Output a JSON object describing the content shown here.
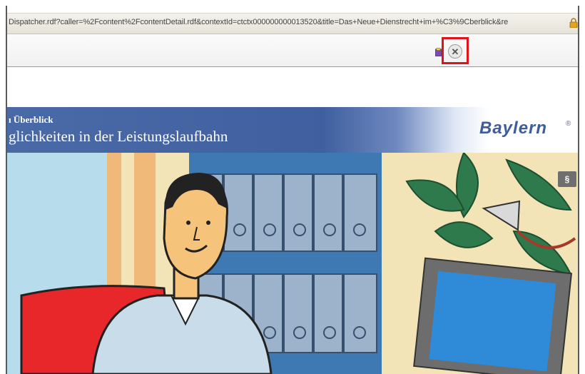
{
  "browser": {
    "url": "Dispatcher.rdf?caller=%2Fcontent%2FcontentDetail.rdf&contextId=ctctx000000000013520&title=Das+Neue+Dienstrecht+im+%C3%9Cberblick&re",
    "lock_icon": "lock-icon",
    "close_icon": "close-icon",
    "tab_icon": "page-icon"
  },
  "banner": {
    "subtitle": "ı Überblick",
    "title": "glichkeiten in der Leistungslaufbahn",
    "logo": "Baylern",
    "logo_reg": "®"
  },
  "scene": {
    "paragraph_button": "§"
  },
  "colors": {
    "banner_blue": "#4a6aa7",
    "highlight_red": "#e0121b"
  }
}
